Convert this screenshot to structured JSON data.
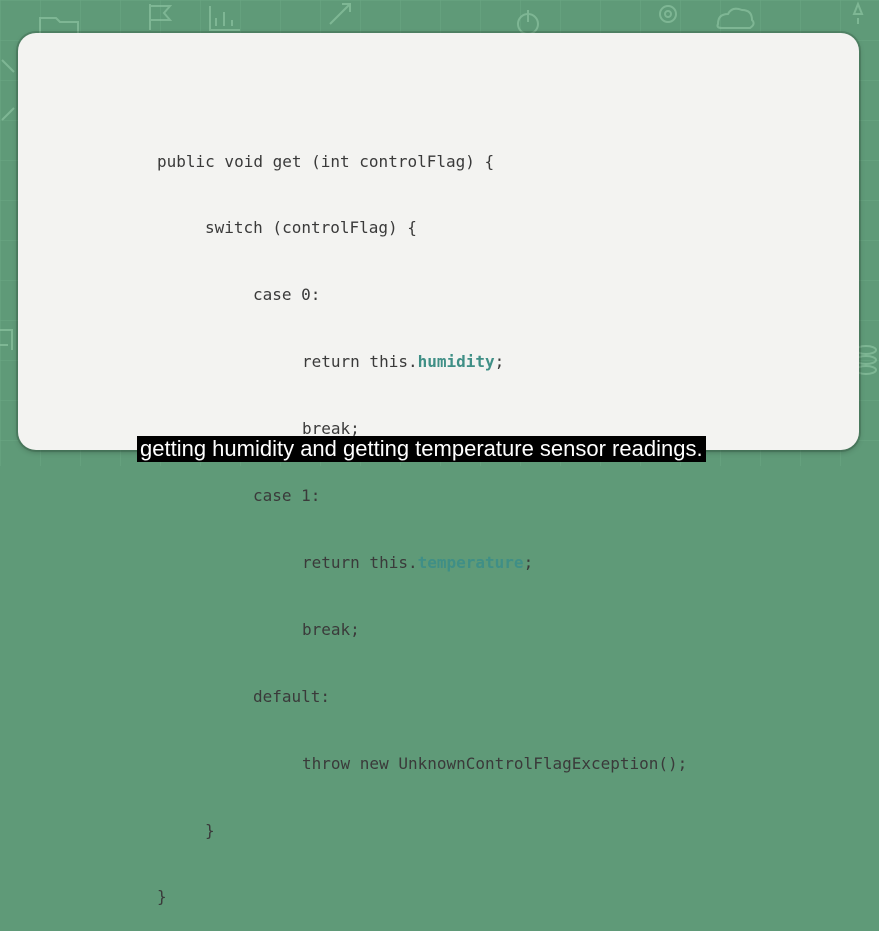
{
  "code": {
    "lines": [
      {
        "text": "public void get (int controlFlag) {"
      },
      {
        "text": "switch (controlFlag) {"
      },
      {
        "text": "case 0:"
      },
      {
        "prefix": "return this.",
        "field": "humidity",
        "suffix": ";"
      },
      {
        "text": "break;"
      },
      {
        "text": "case 1:"
      },
      {
        "prefix": "return this.",
        "field": "temperature",
        "suffix": ";"
      },
      {
        "text": "break;"
      },
      {
        "text": "default:"
      },
      {
        "text": "throw new UnknownControlFlagException();"
      },
      {
        "text": "}"
      },
      {
        "text": "}"
      }
    ]
  },
  "subtitle": "getting humidity and getting temperature sensor readings.",
  "colors": {
    "background": "#5f9a78",
    "card": "#f3f3f1",
    "code_text": "#3a3a3a",
    "field_highlight": "#3f8f86"
  },
  "background_icons": [
    "folder-icon",
    "flag-icon",
    "chart-icon",
    "cloud-icon",
    "power-icon",
    "gear-icon",
    "bulb-icon",
    "arrow-icon",
    "coins-icon"
  ]
}
